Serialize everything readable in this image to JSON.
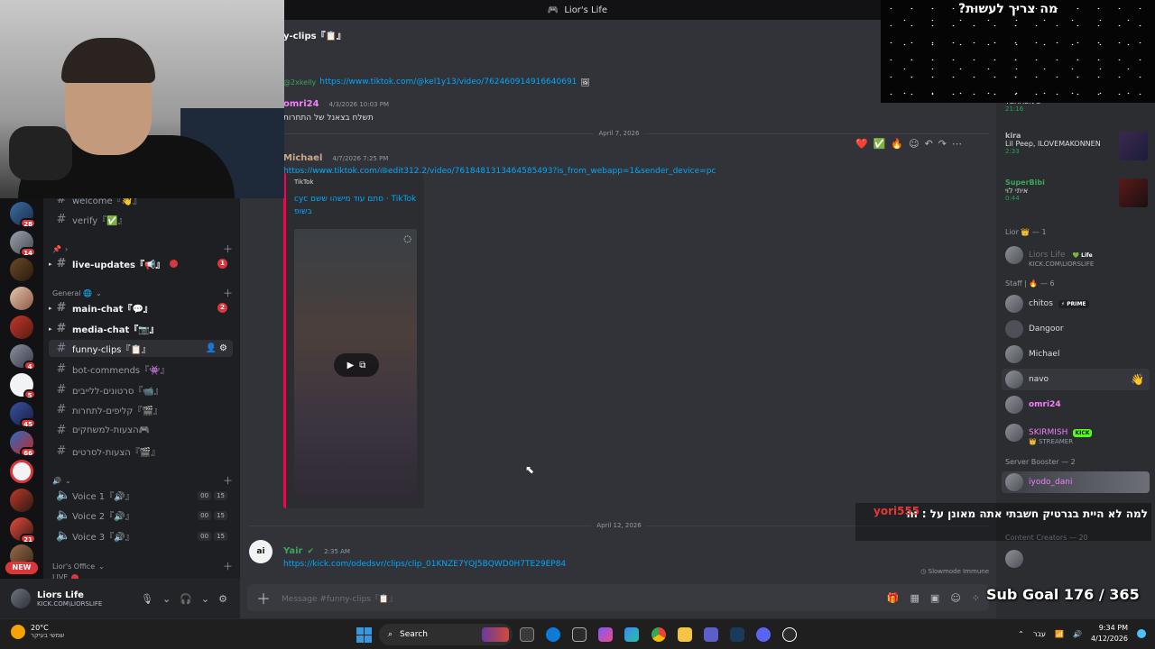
{
  "window": {
    "title": "Lior's Life"
  },
  "chat": {
    "channel_title": "y-clips『📋』",
    "messages": [
      {
        "reply_user": "@2xkelly",
        "link": "https://www.tiktok.com/@kel1y13/video/762460914916640691"
      },
      {
        "author": "omri24",
        "author_color": "#f47fff",
        "time": "4/3/2026 10:03 PM",
        "text": "תשלח בצאנל של התחרות"
      },
      {
        "author": "Michael",
        "author_color": "#c9a88a",
        "time": "4/7/2026 7:25 PM",
        "link": "https://www.tiktok.com/@edit312.2/video/7618481313464585493?is_from_webapp=1&sender_device=pc"
      },
      {
        "author": "Yair",
        "author_color": "#3ba55d",
        "time": "2:35 AM",
        "link": "https://kick.com/odedsvr/clips/clip_01KNZE7YQJ5BQWD0H7TE29EP84"
      }
    ],
    "dividers": [
      "April 7, 2026",
      "April 12, 2026"
    ],
    "embed": {
      "provider": "TikTok",
      "title": "TikTok · סתם עוד מישהו ששם cyc בשופ"
    },
    "composer_placeholder": "Message #funny-clips『📋』",
    "slowmode": "Slowmode Immune"
  },
  "channels": {
    "items": [
      {
        "label": "welcome『👋』",
        "type": "text"
      },
      {
        "label": "verify『✅』",
        "type": "text"
      },
      {
        "label": "live-updates『📢』",
        "type": "text",
        "badge": "1"
      },
      {
        "label": "main-chat『💬』",
        "type": "text",
        "badge": "2"
      },
      {
        "label": "media-chat『📷』",
        "type": "text"
      },
      {
        "label": "funny-clips『📋』",
        "type": "text",
        "active": true
      },
      {
        "label": "bot-commends『👾』",
        "type": "text"
      },
      {
        "label": "סרטונים-ללייבים『📹』",
        "type": "text"
      },
      {
        "label": "קליפים-לתחרות『🎬』",
        "type": "text"
      },
      {
        "label": "הצעות-למשחקים🎮",
        "type": "text"
      },
      {
        "label": "הצעות-לסרטים『🎬』",
        "type": "text"
      },
      {
        "label": "Voice 1『🔊』",
        "type": "voice",
        "counts": [
          "00",
          "15"
        ]
      },
      {
        "label": "Voice 2『🔊』",
        "type": "voice",
        "counts": [
          "00",
          "15"
        ]
      },
      {
        "label": "Voice 3『🔊』",
        "type": "voice",
        "counts": [
          "00",
          "15"
        ]
      }
    ],
    "categories": [
      "General 🌐",
      "Lior's Office"
    ],
    "live_label": "LIVE"
  },
  "rail": {
    "badges": [
      "28",
      "14",
      "4",
      "5",
      "45",
      "66",
      "21",
      "6"
    ],
    "new_label": "NEW"
  },
  "user": {
    "name": "Liors Life",
    "sub": "KICK.COM\\LIORSLIFE"
  },
  "members": {
    "activities": [
      {
        "name": "TERREN'S",
        "duration": "21:16"
      },
      {
        "name": "kira",
        "name_color": "#b9bbbe",
        "text": "Lil Peep, ILOVEMAKONNEN",
        "duration": "2:33"
      },
      {
        "name": "SuperBibi",
        "name_color": "#3ba55d",
        "text": "איתי לוי",
        "duration": "0:44"
      }
    ],
    "categories": [
      "Lior 👑 — 1",
      "Staff | 🔥 — 6",
      "Server Booster — 2",
      "Content Creators — 20"
    ],
    "list": [
      {
        "name": "Liors Life",
        "tag": "💚 Life",
        "sub": "KICK.COM\\LIORSLIFE",
        "dim": true
      },
      {
        "name": "chitos",
        "tag": "⚡ PRIME"
      },
      {
        "name": "Dangoor"
      },
      {
        "name": "Michael"
      },
      {
        "name": "navo"
      },
      {
        "name": "omri24"
      },
      {
        "name": "SKIRMISH",
        "tag": "KICK",
        "sub": "👑 STREAMER"
      },
      {
        "name": "iyodo_dani"
      }
    ]
  },
  "overlay": {
    "stars_title": "מה צריך לעשות?",
    "chat_user": "yori555",
    "chat_message": "למה לא היית בגרטיק חשבתי אתה מאונן על : זה",
    "subgoal": "Sub Goal 176 / 365"
  },
  "taskbar": {
    "weather_temp": "20°C",
    "weather_desc": "שמשי בעיקר",
    "search": "Search",
    "lang": "עבר",
    "time": "9:34 PM",
    "date": "4/12/2026"
  }
}
